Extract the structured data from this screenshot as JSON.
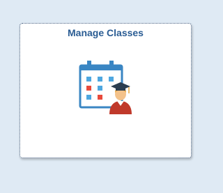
{
  "tile": {
    "title": "Manage Classes",
    "icon": "calendar-student-icon"
  },
  "colors": {
    "page_background": "#dfeaf4",
    "tile_background": "#ffffff",
    "title": "#2a5c93",
    "calendar_blue": "#3a86c3",
    "calendar_cell": "#4ea7e0",
    "calendar_highlight": "#e84a3c",
    "gown_red": "#c0392b",
    "cap_dark": "#2c3e50"
  }
}
